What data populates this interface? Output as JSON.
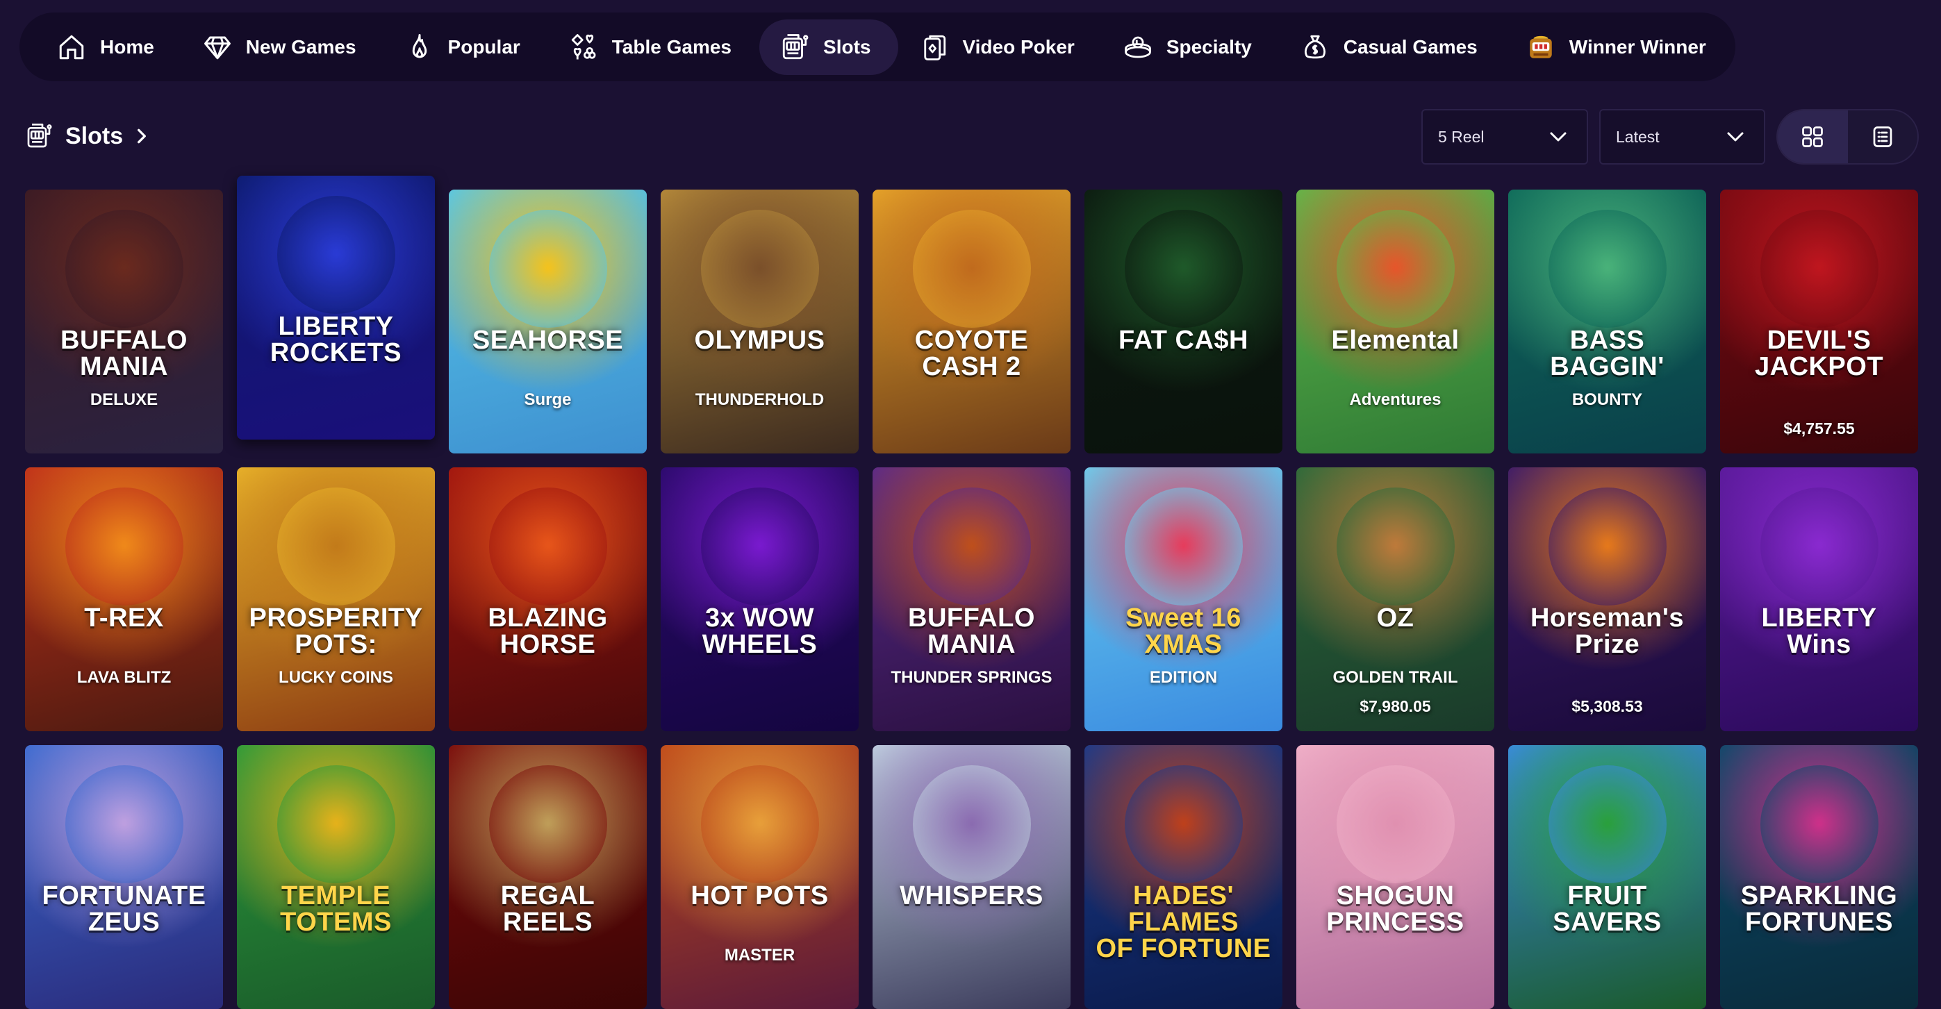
{
  "nav": {
    "items": [
      {
        "label": "Home",
        "icon": "home-icon"
      },
      {
        "label": "New Games",
        "icon": "diamond-icon"
      },
      {
        "label": "Popular",
        "icon": "flame-icon"
      },
      {
        "label": "Table Games",
        "icon": "card-suits-icon"
      },
      {
        "label": "Slots",
        "icon": "slot-machine-icon",
        "active": true
      },
      {
        "label": "Video Poker",
        "icon": "playing-cards-icon"
      },
      {
        "label": "Specialty",
        "icon": "bingo-ball-icon"
      },
      {
        "label": "Casual Games",
        "icon": "money-bag-icon"
      },
      {
        "label": "Winner Winner",
        "icon": "winner-slot-icon"
      }
    ]
  },
  "page": {
    "title": "Slots",
    "reel_filter": "5 Reel",
    "sort": "Latest"
  },
  "games": [
    {
      "title": "BUFFALO\nMANIA",
      "subtitle": "DELUXE",
      "jackpot": "",
      "colors": [
        "#3a1a24",
        "#6b2a1e",
        "#2a2240"
      ]
    },
    {
      "title": "LIBERTY\nROCKETS",
      "subtitle": "",
      "jackpot": "",
      "colors": [
        "#0d1b6e",
        "#2a3bd6",
        "#1a0f7a"
      ]
    },
    {
      "title": "SEAHORSE",
      "subtitle": "Surge",
      "jackpot": "",
      "colors": [
        "#56c7e8",
        "#f6c21a",
        "#3e8fd0"
      ]
    },
    {
      "title": "OLYMPUS",
      "subtitle": "THUNDERHOLD",
      "jackpot": "",
      "colors": [
        "#b58a3a",
        "#7a4f2a",
        "#3b2a1f"
      ]
    },
    {
      "title": "COYOTE\nCASH 2",
      "subtitle": "",
      "jackpot": "",
      "colors": [
        "#e6a42a",
        "#c06a1d",
        "#6a3a18"
      ]
    },
    {
      "title": "FAT CA$H",
      "subtitle": "",
      "jackpot": "",
      "colors": [
        "#0c1a10",
        "#1f5a2a",
        "#0a120c"
      ]
    },
    {
      "title": "Elemental",
      "subtitle": "Adventures",
      "jackpot": "",
      "colors": [
        "#5fb84a",
        "#e8542a",
        "#2f7a35"
      ]
    },
    {
      "title": "BASS\nBAGGIN'",
      "subtitle": "BOUNTY",
      "jackpot": "",
      "colors": [
        "#0e6a5a",
        "#4ab37a",
        "#0a3f4a"
      ]
    },
    {
      "title": "DEVIL'S\nJACKPOT",
      "subtitle": "",
      "jackpot": "$4,757.55",
      "colors": [
        "#7a0a12",
        "#c0161f",
        "#3a050a"
      ]
    },
    {
      "title": "T-REX",
      "subtitle": "LAVA BLITZ",
      "jackpot": "",
      "colors": [
        "#c0301a",
        "#f08a1a",
        "#4a1a10"
      ]
    },
    {
      "title": "PROSPERITY\nPOTS:",
      "subtitle": "LUCKY COINS",
      "jackpot": "",
      "colors": [
        "#e8b22a",
        "#c27a1a",
        "#8a3a12"
      ]
    },
    {
      "title": "BLAZING\nHORSE",
      "subtitle": "",
      "jackpot": "",
      "colors": [
        "#a0150f",
        "#e8561a",
        "#4a0a0a"
      ]
    },
    {
      "title": "3x WOW\nWHEELS",
      "subtitle": "",
      "jackpot": "",
      "colors": [
        "#2a0a6a",
        "#7a1ad0",
        "#140540"
      ]
    },
    {
      "title": "BUFFALO\nMANIA",
      "subtitle": "THUNDER SPRINGS",
      "jackpot": "",
      "colors": [
        "#5a2a8a",
        "#c0501a",
        "#2a1040"
      ]
    },
    {
      "title": "Sweet 16\nXMAS",
      "subtitle": "EDITION",
      "jackpot": "",
      "colors": [
        "#6ad0f0",
        "#e83a5a",
        "#3a8ae0"
      ]
    },
    {
      "title": "OZ",
      "subtitle": "GOLDEN TRAIL",
      "jackpot": "$7,980.05",
      "colors": [
        "#2a6a3a",
        "#c07a3a",
        "#1a3a2a"
      ]
    },
    {
      "title": "Horseman's\nPrize",
      "subtitle": "",
      "jackpot": "$5,308.53",
      "colors": [
        "#3a1a6a",
        "#e87a1a",
        "#1a0a3a"
      ]
    },
    {
      "title": "LIBERTY\nWins",
      "subtitle": "",
      "jackpot": "",
      "colors": [
        "#5a1a9a",
        "#8a2ad0",
        "#2a0a5a"
      ]
    },
    {
      "title": "FORTUNATE\nZEUS",
      "subtitle": "",
      "jackpot": "",
      "colors": [
        "#3a6ad0",
        "#c0a0e0",
        "#2a2a7a"
      ]
    },
    {
      "title": "TEMPLE\nTOTEMS",
      "subtitle": "",
      "jackpot": "",
      "colors": [
        "#2a9a3a",
        "#e8b21a",
        "#1a5a2a"
      ]
    },
    {
      "title": "REGAL\nREELS",
      "subtitle": "",
      "jackpot": "",
      "colors": [
        "#7a0a0a",
        "#c0a05a",
        "#3a0505"
      ]
    },
    {
      "title": "HOT POTS",
      "subtitle": "MASTER",
      "jackpot": "",
      "colors": [
        "#c04a1a",
        "#e8a03a",
        "#5a1a3a"
      ]
    },
    {
      "title": "WHISPERS",
      "subtitle": "",
      "jackpot": "",
      "colors": [
        "#c0d0e0",
        "#8a6ab0",
        "#3a3a5a"
      ]
    },
    {
      "title": "HADES' FLAMES\nOF FORTUNE",
      "subtitle": "",
      "jackpot": "",
      "colors": [
        "#1a3a8a",
        "#c0401a",
        "#0a1a4a"
      ]
    },
    {
      "title": "SHOGUN\nPRINCESS",
      "subtitle": "",
      "jackpot": "",
      "colors": [
        "#f0b0c8",
        "#e090b0",
        "#b06a9a"
      ]
    },
    {
      "title": "FRUIT\nSAVERS",
      "subtitle": "",
      "jackpot": "",
      "colors": [
        "#3a8ae0",
        "#2aa03a",
        "#1a5a2a"
      ]
    },
    {
      "title": "SPARKLING\nFORTUNES",
      "subtitle": "",
      "jackpot": "",
      "colors": [
        "#0a4a6a",
        "#d0308a",
        "#0a2a3a"
      ]
    }
  ]
}
